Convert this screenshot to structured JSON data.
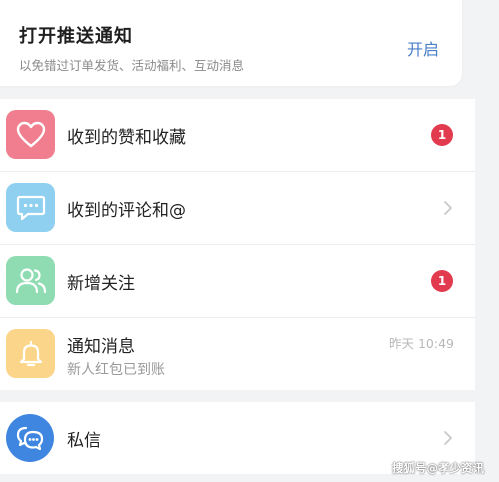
{
  "push": {
    "title": "打开推送通知",
    "subtitle": "以免错过订单发货、活动福利、互动消息",
    "action": "开启"
  },
  "list": {
    "items": [
      {
        "name": "likes",
        "label": "收到的赞和收藏",
        "badge": "1",
        "icon": "heart-icon",
        "color": "#f07e8e"
      },
      {
        "name": "comments",
        "label": "收到的评论和@",
        "icon": "comment-bubble-icon",
        "color": "#8fd0f0"
      },
      {
        "name": "followers",
        "label": "新增关注",
        "badge": "1",
        "icon": "users-icon",
        "color": "#8fdcb3"
      },
      {
        "name": "notifications",
        "label": "通知消息",
        "sub": "新人红包已到账",
        "time": "昨天 10:49",
        "icon": "bell-icon",
        "color": "#fbd68a"
      }
    ]
  },
  "dm": {
    "label": "私信",
    "icon": "chat-bubbles-icon",
    "color": "#3f86e0"
  },
  "watermark": "搜狐号@孝少资讯"
}
